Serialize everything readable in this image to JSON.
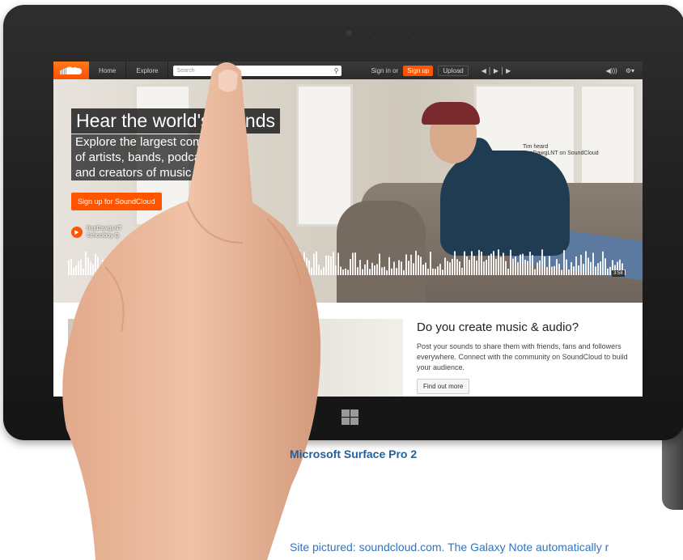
{
  "site": {
    "nav_home": "Home",
    "nav_explore": "Explore",
    "search_placeholder": "Search",
    "sign_in": "Sign in or",
    "sign_up": "Sign up",
    "upload": "Upload"
  },
  "hero": {
    "title": "Hear the world's sounds",
    "sub_line1": "Explore the largest community",
    "sub_line2": "of artists, bands, podcasters",
    "sub_line3": "and creators of music & audio",
    "cta": "Sign up for SoundCloud",
    "track_line1": "BopDawgLNT",
    "track_line2": "Schoolboy Q",
    "credit_line1": "Tim heard",
    "credit_line2": "BopDawgLNT on SoundCloud",
    "time": "3:58"
  },
  "promo": {
    "title": "Do you create music & audio?",
    "body": "Post your sounds to share them with friends, fans and followers everywhere. Connect with the community on SoundCloud to build your audience.",
    "button": "Find out more"
  },
  "caption": {
    "title": "Microsoft Surface Pro 2",
    "body": "Site pictured: soundcloud.com. The Galaxy Note automatically r"
  },
  "colors": {
    "accent": "#ff5500",
    "caption_blue": "#1f5f9e"
  }
}
